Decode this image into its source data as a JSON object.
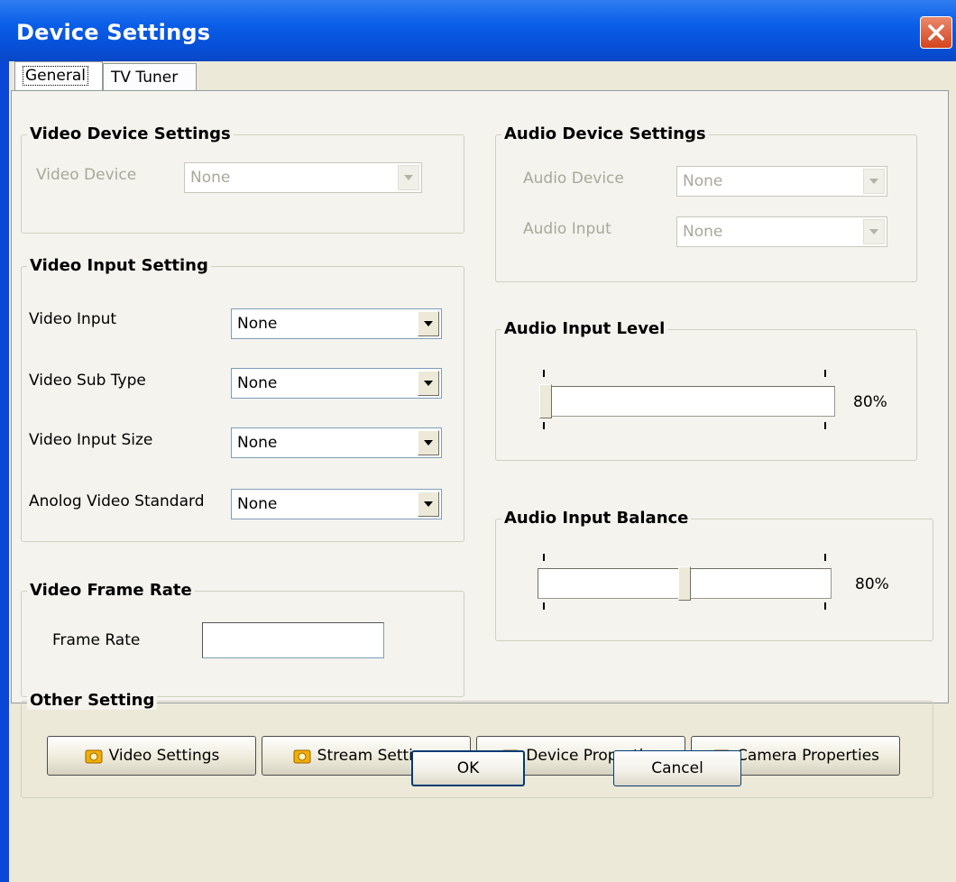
{
  "window": {
    "title": "Device Settings"
  },
  "tabs": [
    {
      "label": "General"
    },
    {
      "label": "TV Tuner"
    }
  ],
  "video_device": {
    "title": "Video Device Settings",
    "device_label": "Video Device",
    "device_value": "None"
  },
  "video_input": {
    "title": "Video Input Setting",
    "rows": [
      {
        "label": "Video Input",
        "value": "None"
      },
      {
        "label": "Video Sub Type",
        "value": "None"
      },
      {
        "label": "Video Input Size",
        "value": "None"
      },
      {
        "label": "Anolog Video Standard",
        "value": "None"
      }
    ]
  },
  "frame_rate": {
    "title": "Video Frame Rate",
    "label": "Frame Rate",
    "value": ""
  },
  "audio_device": {
    "title": "Audio Device Settings",
    "device_label": "Audio Device",
    "device_value": "None",
    "input_label": "Audio Input",
    "input_value": "None"
  },
  "audio_level": {
    "title": "Audio Input Level",
    "percent_text": "80%",
    "position": 0.0
  },
  "audio_balance": {
    "title": "Audio Input Balance",
    "percent_text": "80%",
    "position": 0.5
  },
  "other": {
    "title": "Other Setting",
    "buttons": [
      {
        "label": "Video Settings",
        "icon": "gear-folder-icon"
      },
      {
        "label": "Stream Settings",
        "icon": "gear-folder-icon"
      },
      {
        "label": "Device Properties",
        "icon": "gear-folder-icon"
      },
      {
        "label": "Camera Properties",
        "icon": "gear-folder-icon"
      }
    ]
  },
  "footer": {
    "ok_label": "OK",
    "cancel_label": "Cancel"
  },
  "colors": {
    "titlebar": "#0b5ee8",
    "face": "#ece9d8",
    "panel": "#f4f3ee",
    "close": "#d4441f"
  }
}
